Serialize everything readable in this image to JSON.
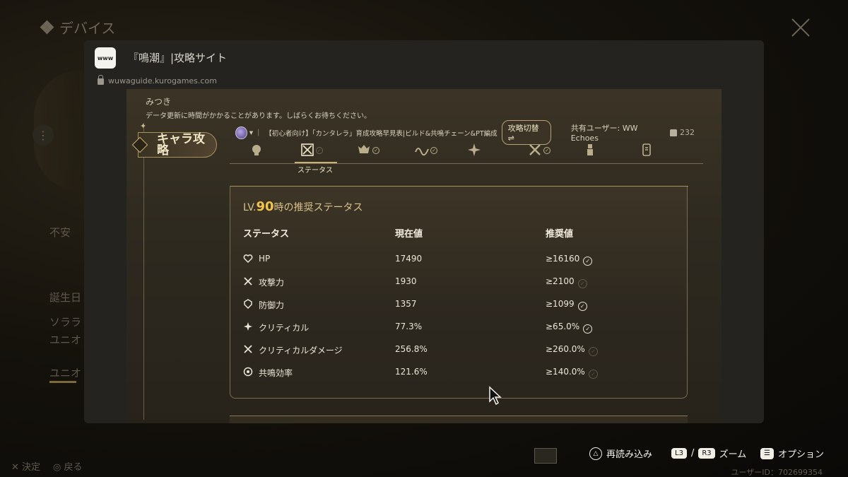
{
  "background": {
    "header": "デバイス",
    "texts": [
      "不安",
      "誕生日",
      "ソララ",
      "ユニオ",
      "ユニオ"
    ]
  },
  "window": {
    "app_icon_text": "www",
    "title": "『鳴潮』|攻略サイト",
    "url": "wuwaguide.kurogames.com"
  },
  "page": {
    "character_name": "みつき",
    "notice": "データ更新に時間がかかることがあります。しばらくお待ちください。",
    "guide_title": "【初心者向け】「カンタレラ」育成攻略早見表|ビルド&共鳴チェーン&PT編成",
    "switch_label": "攻略切替",
    "shared_user": "共有ユーザー: WW Echoes",
    "likes": "232",
    "section_badge": "キャラ攻略",
    "tabs": [
      {
        "name": "profile",
        "icon": "head-icon",
        "checked": false
      },
      {
        "name": "status",
        "icon": "status-icon",
        "checked": true,
        "active": true,
        "label": "ステータス"
      },
      {
        "name": "weapon",
        "icon": "demon-icon",
        "checked": true
      },
      {
        "name": "echo",
        "icon": "wave-icon",
        "checked": true
      },
      {
        "name": "skill",
        "icon": "sparkle-icon",
        "checked": false
      },
      {
        "name": "team",
        "icon": "swords-icon",
        "checked": true
      },
      {
        "name": "chain",
        "icon": "figure-icon",
        "checked": false
      },
      {
        "name": "memo",
        "icon": "document-icon",
        "checked": false
      }
    ],
    "status_panel": {
      "title_prefix": "LV.",
      "level": "90",
      "title_suffix": "時の推奨ステータス",
      "headers": {
        "stat": "ステータス",
        "current": "現在値",
        "recommended": "推奨値"
      },
      "rows": [
        {
          "icon": "heart-icon",
          "name": "HP",
          "current": "17490",
          "recommended": "≥16160",
          "met": true
        },
        {
          "icon": "attack-icon",
          "name": "攻撃力",
          "current": "1930",
          "recommended": "≥2100",
          "met": false
        },
        {
          "icon": "shield-icon",
          "name": "防御力",
          "current": "1357",
          "recommended": "≥1099",
          "met": true
        },
        {
          "icon": "crit-icon",
          "name": "クリティカル",
          "current": "77.3%",
          "recommended": "≥65.0%",
          "met": true
        },
        {
          "icon": "crit-damage-icon",
          "name": "クリティカルダメージ",
          "current": "256.8%",
          "recommended": "≥260.0%",
          "met": false
        },
        {
          "icon": "resonance-icon",
          "name": "共鳴効率",
          "current": "121.6%",
          "recommended": "≥140.0%",
          "met": false
        }
      ]
    }
  },
  "bottom_bar": {
    "reload": "再読み込み",
    "l3": "L3",
    "r3": "R3",
    "zoom": "ズーム",
    "options": "オプション",
    "left_hints": [
      "決定",
      "戻る"
    ],
    "user_id": "ユーザーID：702699354"
  }
}
